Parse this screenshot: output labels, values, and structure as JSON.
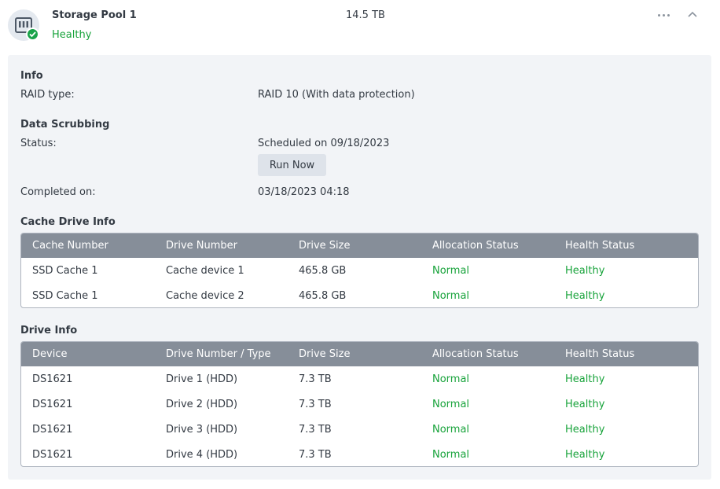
{
  "pool": {
    "name": "Storage Pool 1",
    "status": "Healthy",
    "size": "14.5 TB"
  },
  "info": {
    "title": "Info",
    "raid_label": "RAID type:",
    "raid_value": "RAID 10 (With data protection)"
  },
  "scrubbing": {
    "title": "Data Scrubbing",
    "status_label": "Status:",
    "status_value": "Scheduled on 09/18/2023",
    "run_now": "Run Now",
    "completed_label": "Completed on:",
    "completed_value": "03/18/2023 04:18"
  },
  "cache": {
    "title": "Cache Drive Info",
    "columns": [
      "Cache Number",
      "Drive Number",
      "Drive Size",
      "Allocation Status",
      "Health Status"
    ],
    "rows": [
      [
        "SSD Cache 1",
        "Cache device 1",
        "465.8 GB",
        "Normal",
        "Healthy"
      ],
      [
        "SSD Cache 1",
        "Cache device 2",
        "465.8 GB",
        "Normal",
        "Healthy"
      ]
    ]
  },
  "drives": {
    "title": "Drive Info",
    "columns": [
      "Device",
      "Drive Number / Type",
      "Drive Size",
      "Allocation Status",
      "Health Status"
    ],
    "rows": [
      [
        "DS1621",
        "Drive 1 (HDD)",
        "7.3 TB",
        "Normal",
        "Healthy"
      ],
      [
        "DS1621",
        "Drive 2 (HDD)",
        "7.3 TB",
        "Normal",
        "Healthy"
      ],
      [
        "DS1621",
        "Drive 3 (HDD)",
        "7.3 TB",
        "Normal",
        "Healthy"
      ],
      [
        "DS1621",
        "Drive 4 (HDD)",
        "7.3 TB",
        "Normal",
        "Healthy"
      ]
    ]
  },
  "colors": {
    "healthy_green": "#18a33b",
    "table_header": "#868e99",
    "panel_bg": "#f2f4f7"
  },
  "icons": {
    "pool": "storage-pool-icon",
    "status": "check-badge-icon",
    "more": "more-horizontal-icon",
    "collapse": "chevron-up-icon"
  }
}
